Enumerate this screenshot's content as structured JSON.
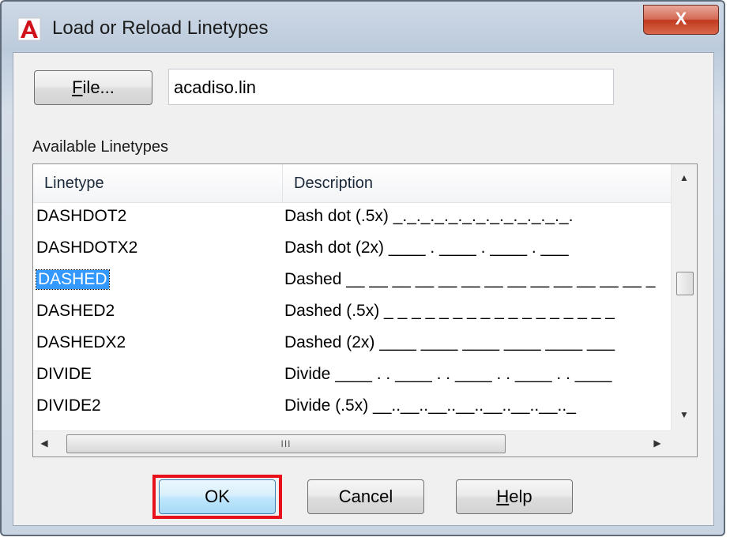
{
  "window": {
    "title": "Load or Reload Linetypes",
    "close_label": "X",
    "app_icon": "autocad-icon"
  },
  "file": {
    "button_label_access": "F",
    "button_label_rest": "ile...",
    "filename": "acadiso.lin"
  },
  "list": {
    "section_label": "Available Linetypes",
    "columns": [
      "Linetype",
      "Description"
    ],
    "rows": [
      {
        "linetype": "DASHDOT2",
        "description": "Dash dot (.5x) _._._._._._._._._._._._._."
      },
      {
        "linetype": "DASHDOTX2",
        "description": "Dash dot (2x) ____  .  ____  .  ____  .  ___"
      },
      {
        "linetype": "DASHED",
        "description": "Dashed __ __ __ __ __ __ __ __ __ __ __ __ __ _",
        "selected": true
      },
      {
        "linetype": "DASHED2",
        "description": "Dashed (.5x) _ _ _ _ _ _ _ _ _ _ _ _ _ _ _ _ _"
      },
      {
        "linetype": "DASHEDX2",
        "description": "Dashed (2x) ____  ____  ____  ____  ____  ___"
      },
      {
        "linetype": "DIVIDE",
        "description": "Divide ____ . . ____ . . ____ . . ____ . . ____"
      },
      {
        "linetype": "DIVIDE2",
        "description": "Divide (.5x) __..__..__..__..__..__..__.._"
      }
    ],
    "hscroll_grip": "III"
  },
  "buttons": {
    "ok": "OK",
    "cancel": "Cancel",
    "help_access": "H",
    "help_rest": "elp"
  },
  "colors": {
    "selection": "#3399ff",
    "highlight_box": "#e8101a",
    "close_button": "#c1391f"
  }
}
